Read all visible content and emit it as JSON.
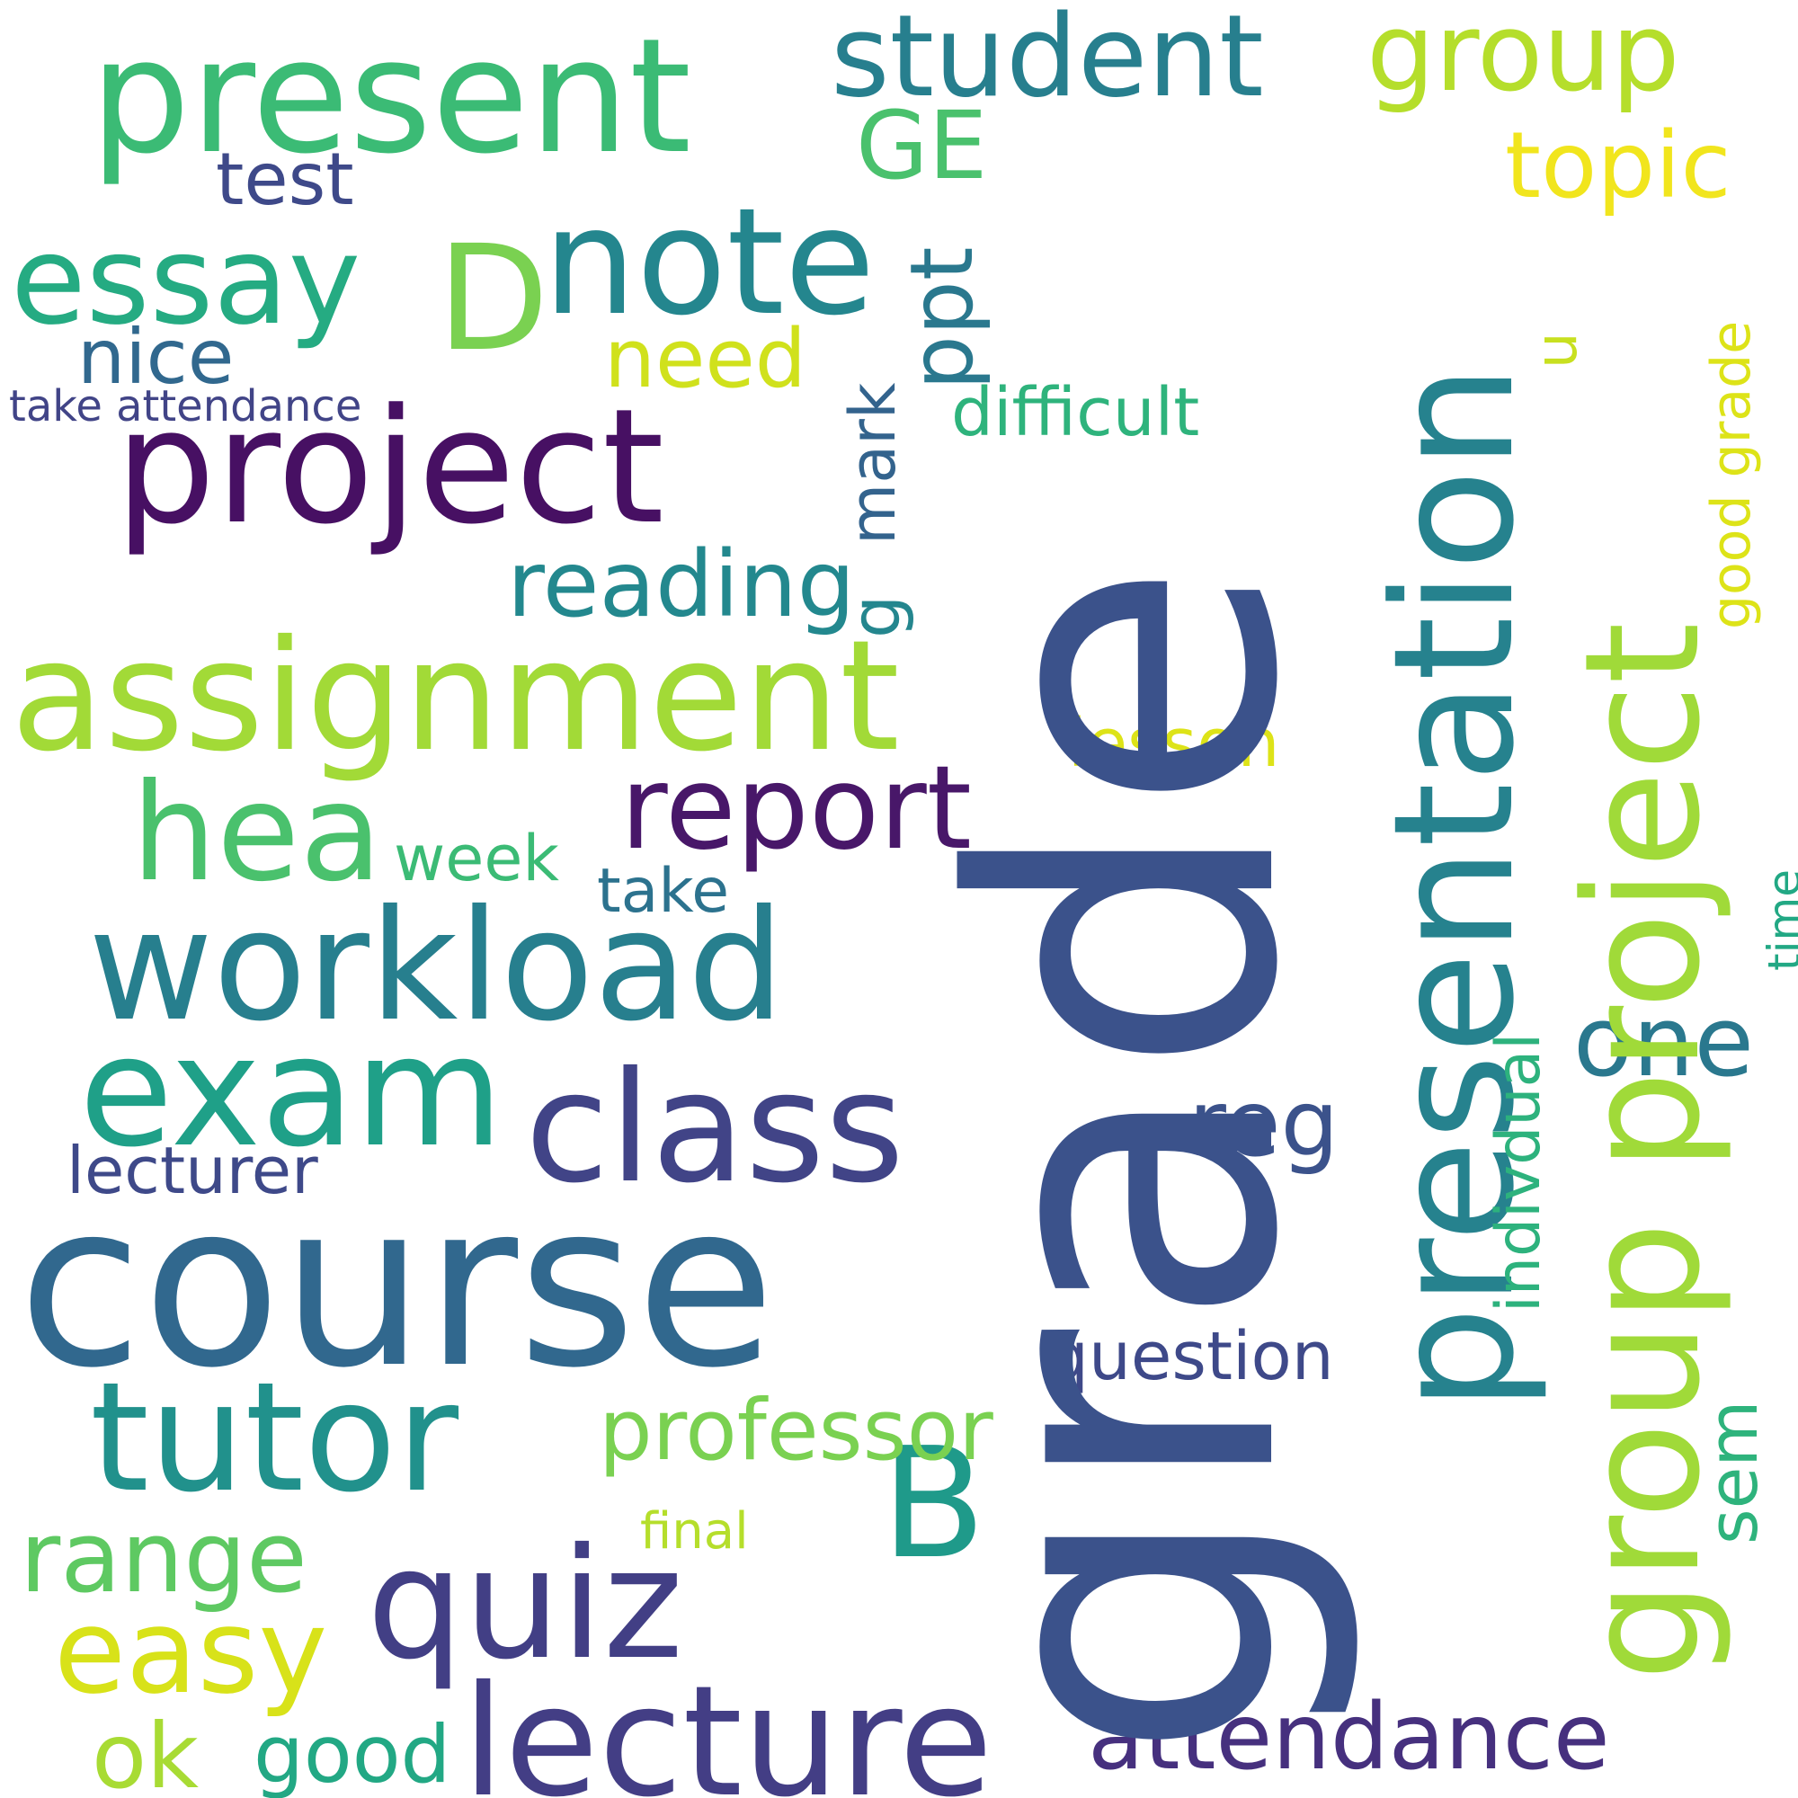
{
  "words": [
    {
      "text": "grade",
      "color": "#3b528b"
    },
    {
      "text": "course",
      "color": "#31688e"
    },
    {
      "text": "presentation",
      "color": "#26828e"
    },
    {
      "text": "group project",
      "color": "#a0da39"
    },
    {
      "text": "project",
      "color": "#471063"
    },
    {
      "text": "present",
      "color": "#3bbb75"
    },
    {
      "text": "assignment",
      "color": "#a2da37"
    },
    {
      "text": "workload",
      "color": "#277f8e"
    },
    {
      "text": "exam",
      "color": "#1fa088"
    },
    {
      "text": "class",
      "color": "#414487"
    },
    {
      "text": "tutor",
      "color": "#21918c"
    },
    {
      "text": "lecture",
      "color": "#433e85"
    },
    {
      "text": "quiz",
      "color": "#423f85"
    },
    {
      "text": "note",
      "color": "#24868e"
    },
    {
      "text": "essay",
      "color": "#25ab82"
    },
    {
      "text": "student",
      "color": "#277f8e"
    },
    {
      "text": "group",
      "color": "#b5de2b"
    },
    {
      "text": "hea",
      "color": "#4ac16d"
    },
    {
      "text": "report",
      "color": "#481769"
    },
    {
      "text": "D",
      "color": "#7ad151"
    },
    {
      "text": "B",
      "color": "#1f9a8a"
    },
    {
      "text": "attendance",
      "color": "#46307e"
    },
    {
      "text": "reading",
      "color": "#23888e"
    },
    {
      "text": "professor",
      "color": "#7ad151"
    },
    {
      "text": "range",
      "color": "#5ec962"
    },
    {
      "text": "easy",
      "color": "#d8e219"
    },
    {
      "text": "ok",
      "color": "#a8db34"
    },
    {
      "text": "good",
      "color": "#22a884"
    },
    {
      "text": "nice",
      "color": "#31688e"
    },
    {
      "text": "test",
      "color": "#3e4989"
    },
    {
      "text": "need",
      "color": "#d0e11c"
    },
    {
      "text": "topic",
      "color": "#f1e51d"
    },
    {
      "text": "GE",
      "color": "#4ac16d"
    },
    {
      "text": "difficult",
      "color": "#2eb37c"
    },
    {
      "text": "lesson",
      "color": "#dde318"
    },
    {
      "text": "week",
      "color": "#3bbb75"
    },
    {
      "text": "take",
      "color": "#2c728e"
    },
    {
      "text": "reg",
      "color": "#3b528b"
    },
    {
      "text": "one",
      "color": "#2a788e"
    },
    {
      "text": "question",
      "color": "#3e4989"
    },
    {
      "text": "lecturer",
      "color": "#3e4989"
    },
    {
      "text": "take attendance",
      "color": "#414487"
    },
    {
      "text": "final",
      "color": "#b5de2b"
    },
    {
      "text": "ppt",
      "color": "#2a788e"
    },
    {
      "text": "mark",
      "color": "#33638d"
    },
    {
      "text": "g",
      "color": "#24868e"
    },
    {
      "text": "indivdual",
      "color": "#2db27d"
    },
    {
      "text": "sem",
      "color": "#2eb37c"
    },
    {
      "text": "u",
      "color": "#c8e020"
    },
    {
      "text": "good grade",
      "color": "#dde318"
    },
    {
      "text": "time",
      "color": "#22a884"
    }
  ]
}
